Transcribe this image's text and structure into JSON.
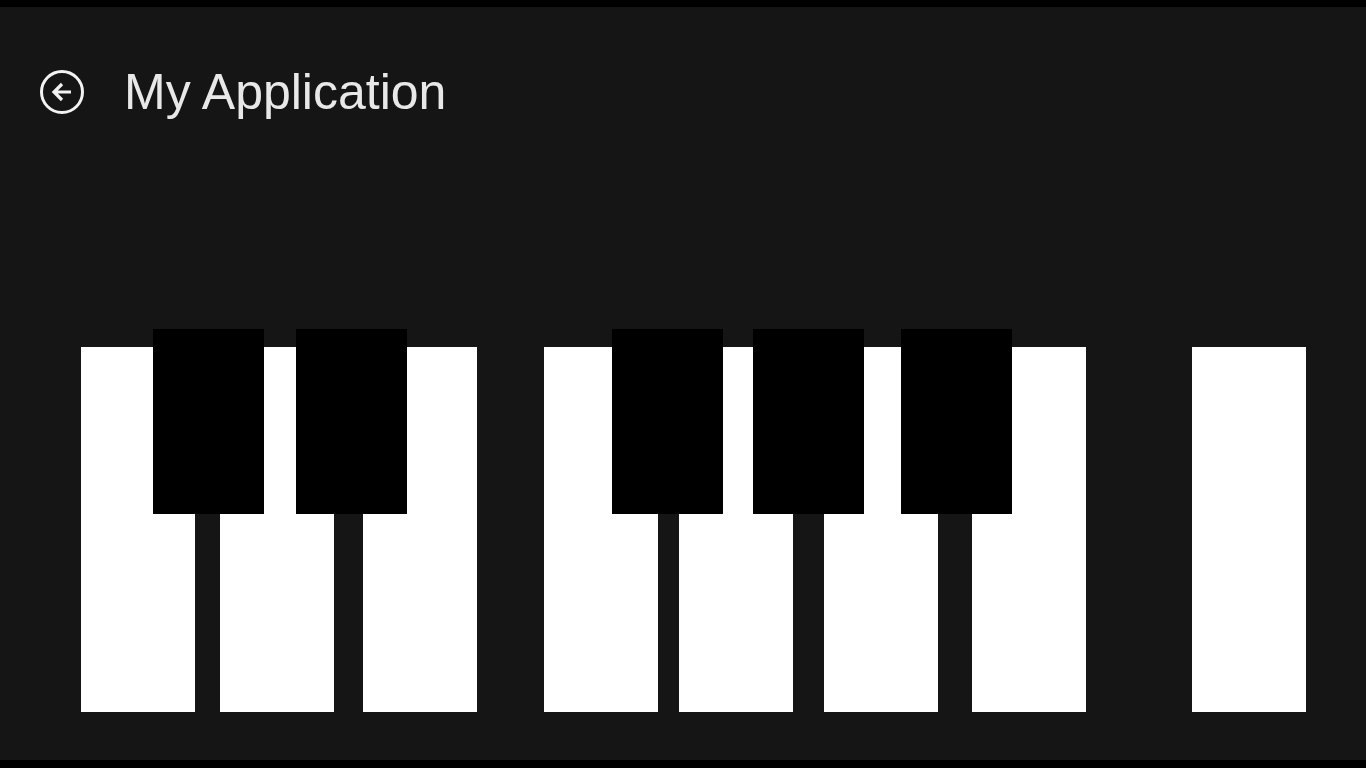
{
  "header": {
    "title": "My Application",
    "back_button": {
      "kind": "back"
    }
  },
  "keys": [
    {
      "kind": "white"
    },
    {
      "kind": "white"
    },
    {
      "kind": "white"
    },
    {
      "kind": "white"
    },
    {
      "kind": "white"
    },
    {
      "kind": "white"
    },
    {
      "kind": "white"
    },
    {
      "kind": "white"
    },
    {
      "kind": "black"
    },
    {
      "kind": "black"
    },
    {
      "kind": "black"
    },
    {
      "kind": "black"
    },
    {
      "kind": "black"
    }
  ]
}
